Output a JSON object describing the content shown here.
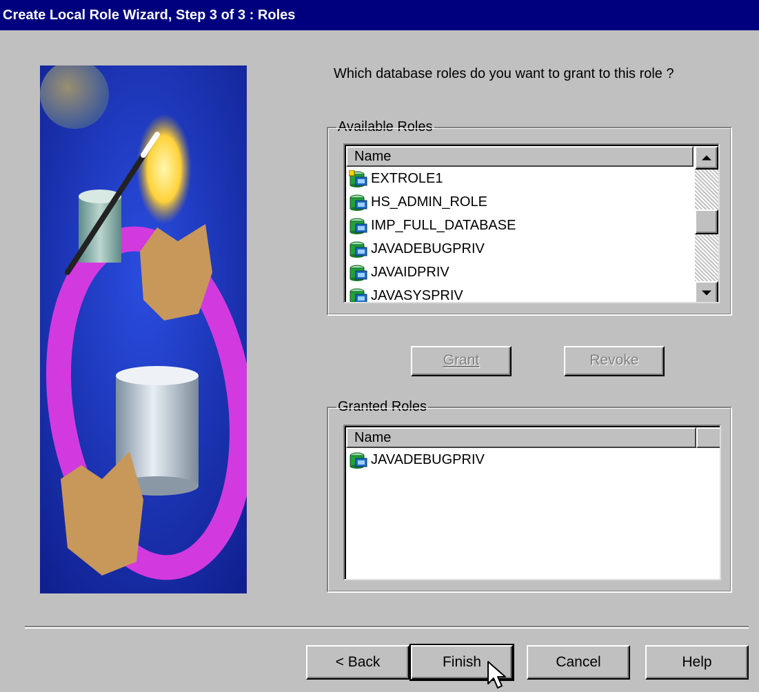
{
  "window": {
    "title": "Create Local Role Wizard, Step 3 of 3 : Roles"
  },
  "question": "Which database roles do you want to grant to this role ?",
  "available": {
    "legend": "Available Roles",
    "column": "Name",
    "items": [
      {
        "label": "EXTROLE1",
        "icon": "external-role-icon"
      },
      {
        "label": "HS_ADMIN_ROLE",
        "icon": "role-icon"
      },
      {
        "label": "IMP_FULL_DATABASE",
        "icon": "role-icon"
      },
      {
        "label": "JAVADEBUGPRIV",
        "icon": "role-icon"
      },
      {
        "label": "JAVAIDPRIV",
        "icon": "role-icon"
      },
      {
        "label": "JAVASYSPRIV",
        "icon": "role-icon"
      }
    ]
  },
  "actions": {
    "grant": "Grant",
    "revoke": "Revoke"
  },
  "granted": {
    "legend": "Granted Roles",
    "column": "Name",
    "items": [
      {
        "label": "JAVADEBUGPRIV",
        "icon": "role-icon"
      }
    ]
  },
  "footer": {
    "back": "< Back",
    "finish": "Finish",
    "cancel": "Cancel",
    "help": "Help"
  },
  "colors": {
    "titlebar": "#00007e",
    "dialog": "#c0c0c0",
    "accent_role_green": "#1fa23a"
  }
}
